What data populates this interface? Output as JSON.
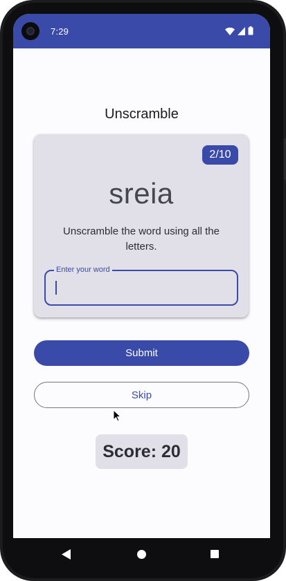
{
  "status_bar": {
    "time": "7:29",
    "icons": [
      "wifi-icon",
      "cellular-signal-icon",
      "battery-icon"
    ],
    "background_color": "#3a4aa8"
  },
  "app": {
    "title": "Unscramble"
  },
  "game_card": {
    "word_count": "2/10",
    "scrambled_word": "sreia",
    "instructions": "Unscramble the word using all the letters.",
    "input_label": "Enter your word",
    "input_value": ""
  },
  "actions": {
    "submit_label": "Submit",
    "skip_label": "Skip"
  },
  "score": {
    "text": "Score: 20"
  },
  "nav_bar": {
    "icons": [
      "back-icon",
      "home-icon",
      "recents-icon"
    ]
  },
  "theme": {
    "primary": "#3a4aa8",
    "surface_variant": "#e1e0e8",
    "background": "#fcfbfe"
  }
}
